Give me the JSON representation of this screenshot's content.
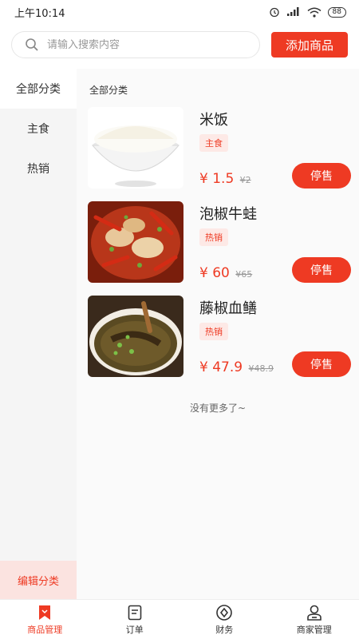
{
  "status_bar": {
    "time": "上午10:14",
    "battery": "88"
  },
  "search": {
    "placeholder": "请输入搜索内容"
  },
  "header": {
    "add_label": "添加商品"
  },
  "sidebar": {
    "items": [
      {
        "label": "全部分类"
      },
      {
        "label": "主食"
      },
      {
        "label": "热销"
      }
    ],
    "edit_label": "编辑分类"
  },
  "content": {
    "title": "全部分类"
  },
  "products": [
    {
      "name": "米饭",
      "tag": "主食",
      "price": "¥ 1.5",
      "old_price": "¥2",
      "action": "停售"
    },
    {
      "name": "泡椒牛蛙",
      "tag": "热销",
      "price": "¥ 60",
      "old_price": "¥65",
      "action": "停售"
    },
    {
      "name": "藤椒血鳝",
      "tag": "热销",
      "price": "¥ 47.9",
      "old_price": "¥48.9",
      "action": "停售"
    }
  ],
  "footer_note": "没有更多了~",
  "tabs": [
    {
      "label": "商品管理",
      "icon": "bookmark-icon"
    },
    {
      "label": "订单",
      "icon": "order-icon"
    },
    {
      "label": "财务",
      "icon": "finance-icon"
    },
    {
      "label": "商家管理",
      "icon": "merchant-icon"
    }
  ],
  "colors": {
    "accent": "#ee3a23"
  }
}
